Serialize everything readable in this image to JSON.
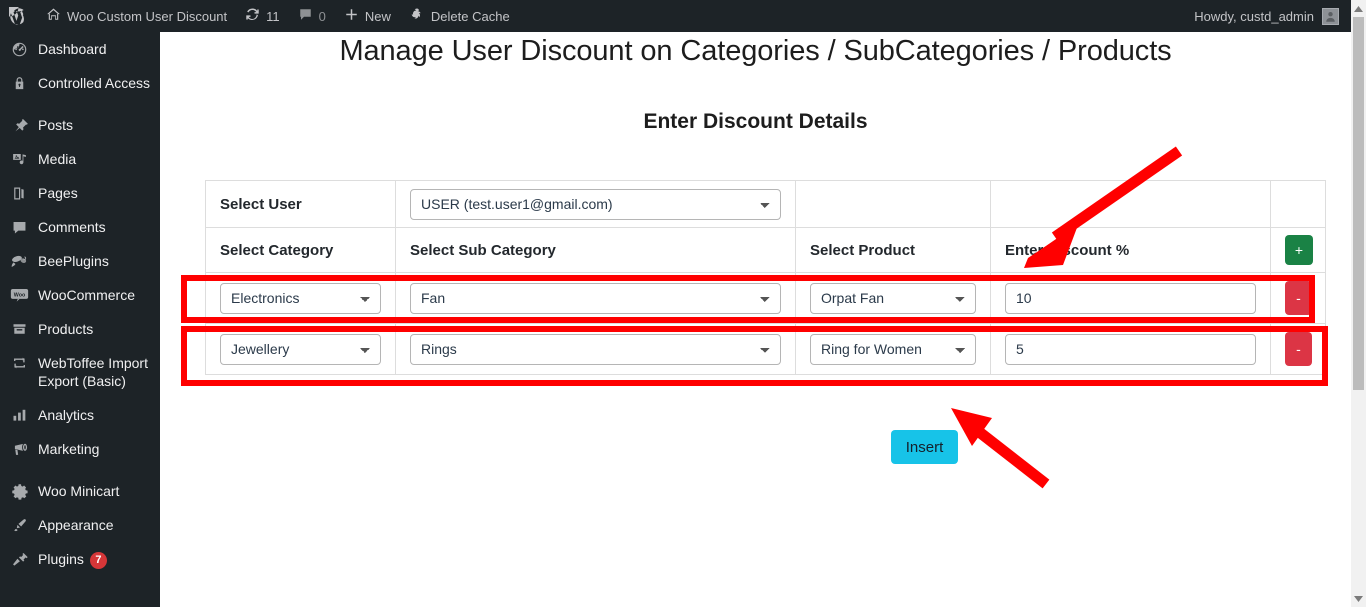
{
  "adminbar": {
    "site_name": "Woo Custom User Discount",
    "updates_count": "11",
    "comments_count": "0",
    "new_label": "New",
    "delete_cache_label": "Delete Cache",
    "howdy": "Howdy, custd_admin"
  },
  "sidebar": {
    "items": [
      {
        "label": "Dashboard",
        "icon": "dashboard-icon"
      },
      {
        "label": "Controlled Access",
        "icon": "lock-icon"
      },
      {
        "label": "Posts",
        "icon": "pin-icon"
      },
      {
        "label": "Media",
        "icon": "media-icon"
      },
      {
        "label": "Pages",
        "icon": "pages-icon"
      },
      {
        "label": "Comments",
        "icon": "comment-icon"
      },
      {
        "label": "BeePlugins",
        "icon": "bee-icon"
      },
      {
        "label": "WooCommerce",
        "icon": "woo-icon"
      },
      {
        "label": "Products",
        "icon": "products-icon"
      },
      {
        "label": "WebToffee Import Export (Basic)",
        "icon": "import-export-icon"
      },
      {
        "label": "Analytics",
        "icon": "analytics-icon"
      },
      {
        "label": "Marketing",
        "icon": "megaphone-icon"
      },
      {
        "label": "Woo Minicart",
        "icon": "gear-icon"
      },
      {
        "label": "Appearance",
        "icon": "brush-icon"
      },
      {
        "label": "Plugins",
        "icon": "plug-icon",
        "badge": "7"
      }
    ]
  },
  "page": {
    "title": "Manage User Discount on Categories / SubCategories / Products",
    "subtitle": "Enter Discount Details"
  },
  "table": {
    "user_row_label": "Select User",
    "user_value": "USER (test.user1@gmail.com)",
    "headers": {
      "category": "Select Category",
      "subcategory": "Select Sub Category",
      "product": "Select Product",
      "discount": "Enter Discount %"
    },
    "add_button_label": "+",
    "remove_button_label": "-",
    "rows": [
      {
        "category": "Electronics",
        "subcategory": "Fan",
        "product": "Orpat Fan",
        "discount": "10"
      },
      {
        "category": "Jewellery",
        "subcategory": "Rings",
        "product": "Ring for Women",
        "discount": "5"
      }
    ]
  },
  "actions": {
    "insert_label": "Insert"
  },
  "annotations": {
    "highlight_color": "#ff0000",
    "arrow_color": "#ff0000"
  }
}
